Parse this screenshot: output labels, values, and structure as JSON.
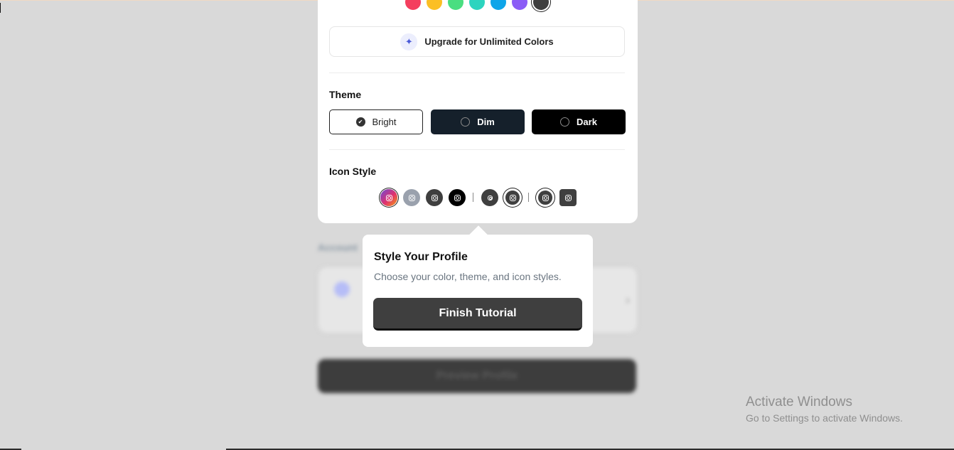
{
  "colors": {
    "swatches": [
      "#f43f5e",
      "#fbbf24",
      "#4ade80",
      "#2dd4bf",
      "#0ea5e9",
      "#8b5cf6",
      "#3f3f3f"
    ],
    "selected_swatch_index": 6,
    "theme_bright_bg": "#ffffff",
    "theme_dim_bg": "#15202b",
    "theme_dark_bg": "#000000",
    "button_dark": "#3f3f3f"
  },
  "upgrade": {
    "label": "Upgrade for Unlimited Colors",
    "icon": "sparkle-icon"
  },
  "theme": {
    "title": "Theme",
    "options": [
      {
        "label": "Bright",
        "selected": true
      },
      {
        "label": "Dim",
        "selected": false
      },
      {
        "label": "Dark",
        "selected": false
      }
    ]
  },
  "icon_style": {
    "title": "Icon Style",
    "options": [
      {
        "name": "gradient-circle",
        "icon": "instagram-icon",
        "selected": true
      },
      {
        "name": "gray-circle",
        "icon": "instagram-icon",
        "selected": false
      },
      {
        "name": "dark-circle",
        "icon": "instagram-icon",
        "selected": false
      },
      {
        "name": "black-circle",
        "icon": "instagram-icon",
        "selected": false
      },
      {
        "name": "small-dark-circle",
        "icon": "instagram-icon",
        "selected": false
      },
      {
        "name": "outlined-circle",
        "icon": "instagram-icon",
        "selected": true
      },
      {
        "name": "outlined-square",
        "icon": "instagram-icon",
        "selected": true
      },
      {
        "name": "dark-square",
        "icon": "instagram-icon",
        "selected": false
      }
    ]
  },
  "tutorial": {
    "title": "Style Your Profile",
    "description": "Choose your color, theme, and icon styles.",
    "finish_label": "Finish Tutorial"
  },
  "background": {
    "preview_label": "Preview Profile"
  },
  "watermark": {
    "title": "Activate Windows",
    "subtitle": "Go to Settings to activate Windows."
  }
}
